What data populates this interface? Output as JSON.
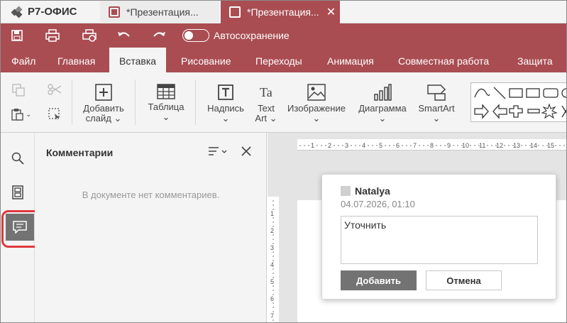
{
  "app": {
    "name": "Р7-ОФИС"
  },
  "tabs": [
    {
      "label": "*Презентация..."
    },
    {
      "label": "*Презентация..."
    }
  ],
  "quickbar": {
    "autosave_label": "Автосохранение"
  },
  "menu": [
    "Файл",
    "Главная",
    "Вставка",
    "Рисование",
    "Переходы",
    "Анимация",
    "Совместная работа",
    "Защита"
  ],
  "active_menu": "Вставка",
  "toolbar": {
    "add_slide": {
      "line1": "Добавить",
      "line2": "слайд"
    },
    "table": "Таблица",
    "caption": "Надпись",
    "text_art": {
      "line1": "Text",
      "line2": "Art"
    },
    "image": "Изображение",
    "chart": "Диаграмма",
    "smartart": "SmartArt"
  },
  "comments_panel": {
    "title": "Комментарии",
    "empty_text": "В документе нет комментариев."
  },
  "comment_popup": {
    "user": "Natalya",
    "date": "04.07.2026, 01:10",
    "text": "Уточнить",
    "add_label": "Добавить",
    "cancel_label": "Отмена"
  },
  "colors": {
    "brand": "#a94d52",
    "highlight": "#e0393e"
  }
}
